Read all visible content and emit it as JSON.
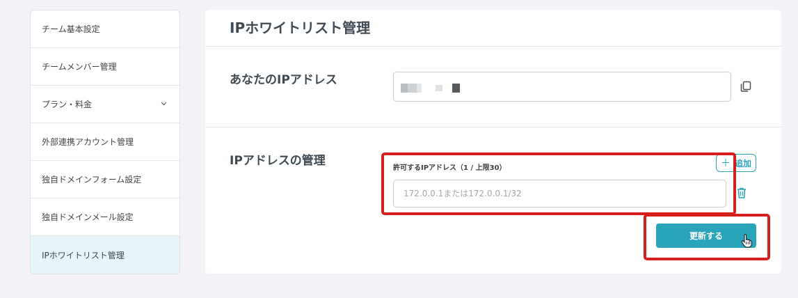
{
  "sidebar": {
    "items": [
      {
        "label": "チーム基本設定"
      },
      {
        "label": "チームメンバー管理"
      },
      {
        "label": "プラン・料金",
        "chevron": "chevron-down-icon"
      },
      {
        "label": "外部連携アカウント管理"
      },
      {
        "label": "独自ドメインフォーム設定"
      },
      {
        "label": "独自ドメインメール設定"
      },
      {
        "label": "IPホワイトリスト管理",
        "active": true
      }
    ]
  },
  "main": {
    "title": "IPホワイトリスト管理",
    "your_ip": {
      "label": "あなたのIPアドレス",
      "value": "",
      "copy_icon": "copy-icon"
    },
    "ip_management": {
      "label": "IPアドレスの管理",
      "field_label": "許可するIPアドレス（1 / 上限30）",
      "add_button": "追加",
      "add_icon": "plus-icon",
      "input_value": "",
      "input_placeholder": "172.0.0.1または172.0.0.1/32",
      "delete_icon": "trash-icon",
      "update_button": "更新する"
    }
  },
  "colors": {
    "accent": "#2aa4b9",
    "highlight": "#d41f1c",
    "active_bg": "#e6f5f9",
    "page_bg": "#f3f3f7"
  }
}
